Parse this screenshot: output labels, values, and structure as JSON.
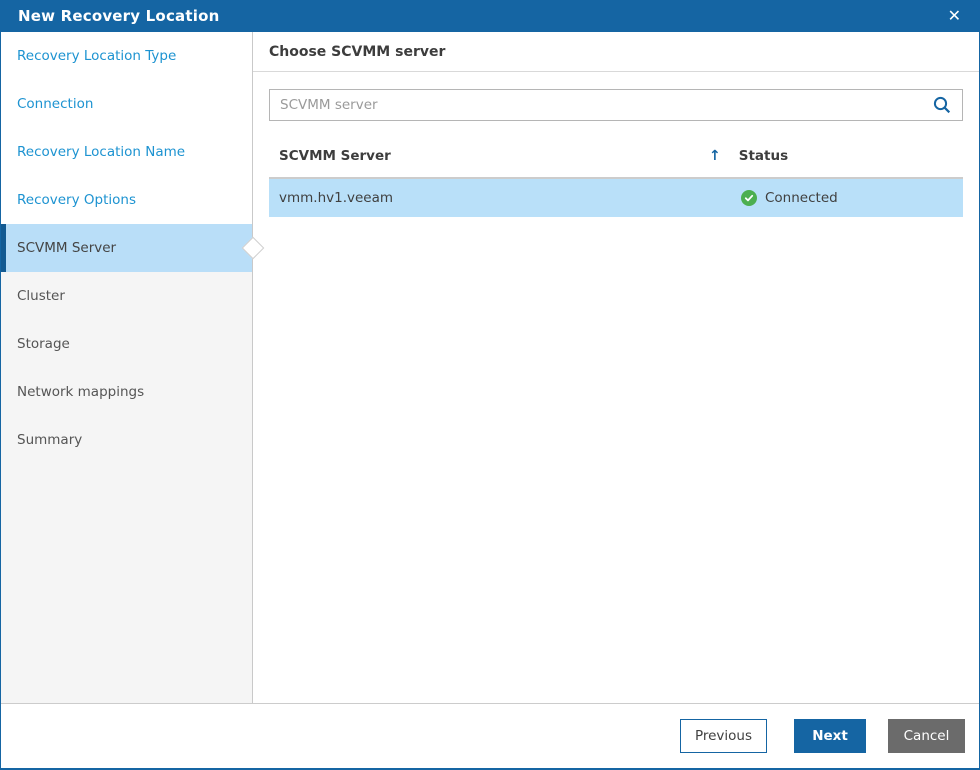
{
  "dialog": {
    "title": "New Recovery Location",
    "close_glyph": "✕"
  },
  "sidebar": {
    "items": [
      {
        "label": "Recovery Location Type",
        "state": "visited"
      },
      {
        "label": "Connection",
        "state": "visited"
      },
      {
        "label": "Recovery Location Name",
        "state": "visited"
      },
      {
        "label": "Recovery Options",
        "state": "visited"
      },
      {
        "label": "SCVMM Server",
        "state": "active"
      },
      {
        "label": "Cluster",
        "state": "upcoming"
      },
      {
        "label": "Storage",
        "state": "upcoming"
      },
      {
        "label": "Network mappings",
        "state": "upcoming"
      },
      {
        "label": "Summary",
        "state": "upcoming"
      }
    ]
  },
  "content": {
    "heading": "Choose SCVMM server",
    "search": {
      "placeholder": "SCVMM server",
      "value": "",
      "icon": "magnifier-icon"
    },
    "table": {
      "columns": [
        {
          "label": "SCVMM Server",
          "sorted": "ascending"
        },
        {
          "label": "Status"
        }
      ],
      "sort_glyph": "↑",
      "rows": [
        {
          "server": "vmm.hv1.veeam",
          "status": "Connected",
          "status_icon": "check-circle-icon",
          "selected": true
        }
      ]
    }
  },
  "footer": {
    "previous_label": "Previous",
    "next_label": "Next",
    "cancel_label": "Cancel"
  },
  "colors": {
    "accent_blue": "#1565a3",
    "link_blue": "#1d93d1",
    "active_step_blue": "#b9def8",
    "row_highlight_blue": "#b9e0f9",
    "status_green": "#4caf50",
    "cancel_gray": "#6b6b6b"
  }
}
